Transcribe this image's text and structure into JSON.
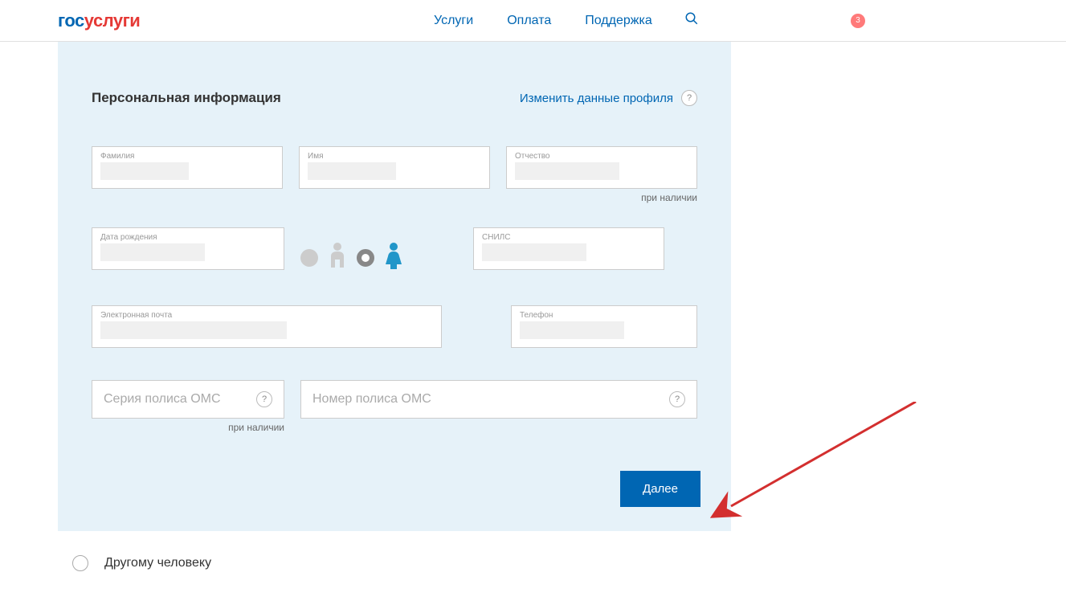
{
  "header": {
    "logo_part1": "гос",
    "logo_part2": "услуги",
    "nav": {
      "services": "Услуги",
      "payment": "Оплата",
      "support": "Поддержка"
    },
    "notif_count": "3"
  },
  "section": {
    "title": "Персональная информация",
    "change_profile": "Изменить данные профиля"
  },
  "fields": {
    "lastname": "Фамилия",
    "firstname": "Имя",
    "patronymic": "Отчество",
    "patronymic_hint": "при наличии",
    "birthdate": "Дата рождения",
    "snils": "СНИЛС",
    "email": "Электронная почта",
    "phone": "Телефон"
  },
  "oms": {
    "series_placeholder": "Серия полиса ОМС",
    "series_hint": "при наличии",
    "number_placeholder": "Номер полиса ОМС"
  },
  "buttons": {
    "next": "Далее"
  },
  "other_person": "Другому человеку",
  "help_symbol": "?"
}
